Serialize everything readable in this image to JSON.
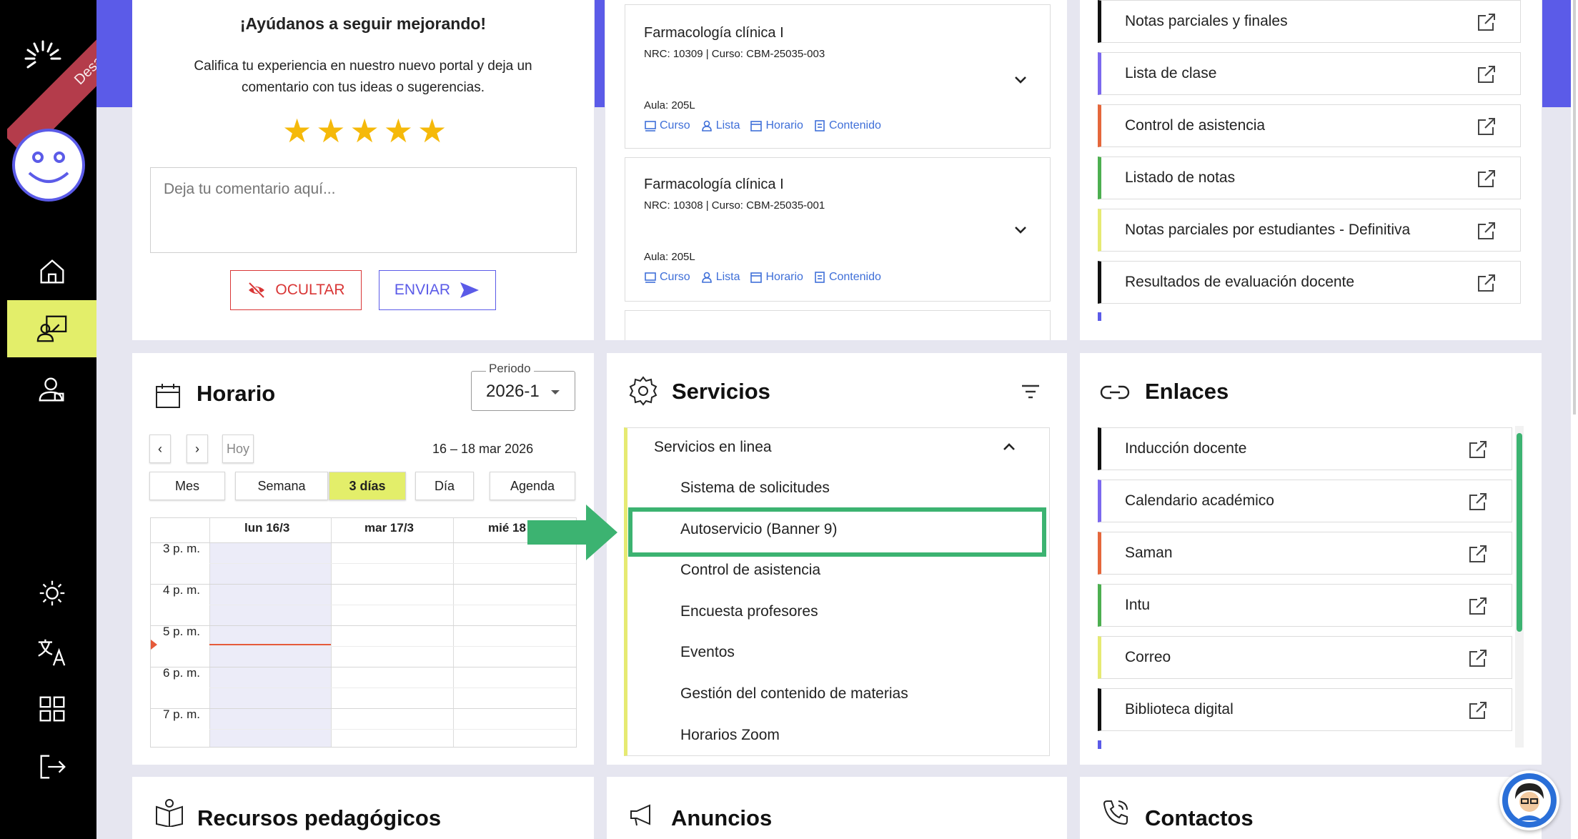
{
  "sidebar": {
    "ribbon_label": "Desarrollo",
    "items": [
      {
        "name": "home-icon"
      },
      {
        "name": "teacher-screen-icon"
      },
      {
        "name": "user-icon"
      },
      {
        "name": "theme-icon"
      },
      {
        "name": "language-icon"
      },
      {
        "name": "apps-grid-icon"
      },
      {
        "name": "logout-icon"
      }
    ]
  },
  "feedback": {
    "title": "¡Ayúdanos a seguir mejorando!",
    "text_line1": "Califica tu experiencia en nuestro nuevo portal y deja un",
    "text_line2": "comentario con tus ideas o sugerencias.",
    "stars": 5,
    "comment_placeholder": "Deja tu comentario aquí...",
    "hide_label": "OCULTAR",
    "send_label": "ENVIAR"
  },
  "courses": [
    {
      "name": "Farmacología clínica I",
      "nrc": "NRC: 10309 | Curso: CBM-25035-003",
      "aula": "Aula: 205L"
    },
    {
      "name": "Farmacología clínica I",
      "nrc": "NRC: 10308 | Curso: CBM-25035-001",
      "aula": "Aula: 205L"
    }
  ],
  "course_links": {
    "curso": "Curso",
    "lista": "Lista",
    "horario": "Horario",
    "contenido": "Contenido"
  },
  "reports": [
    {
      "label": "Notas parciales y finales",
      "color": "#111111"
    },
    {
      "label": "Lista de clase",
      "color": "#7b68ee"
    },
    {
      "label": "Control de asistencia",
      "color": "#e5673b"
    },
    {
      "label": "Listado de notas",
      "color": "#4caf50"
    },
    {
      "label": "Notas parciales por estudiantes - Definitiva",
      "color": "#e6ea72"
    },
    {
      "label": "Resultados de evaluación docente",
      "color": "#111111"
    }
  ],
  "horario": {
    "title": "Horario",
    "period_label": "Periodo",
    "period_value": "2026-1",
    "prev": "‹",
    "next": "›",
    "today": "Hoy",
    "range": "16 – 18 mar 2026",
    "views": [
      "Mes",
      "Semana",
      "3 días",
      "Día",
      "Agenda"
    ],
    "active_view": "3 días",
    "days": [
      "lun 16/3",
      "mar 17/3",
      "mié 18"
    ],
    "hours": [
      "3 p. m.",
      "4 p. m.",
      "5 p. m.",
      "6 p. m.",
      "7 p. m."
    ]
  },
  "servicios": {
    "title": "Servicios",
    "group": "Servicios en linea",
    "items": [
      "Sistema de solicitudes",
      "Autoservicio (Banner 9)",
      "Control de asistencia",
      "Encuesta profesores",
      "Eventos",
      "Gestión del contenido de materias",
      "Horarios Zoom"
    ],
    "highlighted": "Autoservicio (Banner 9)"
  },
  "enlaces": {
    "title": "Enlaces",
    "items": [
      {
        "label": "Inducción docente",
        "color": "#111111"
      },
      {
        "label": "Calendario académico",
        "color": "#7b68ee"
      },
      {
        "label": "Saman",
        "color": "#e5673b"
      },
      {
        "label": "Intu",
        "color": "#4caf50"
      },
      {
        "label": "Correo",
        "color": "#e6ea72"
      },
      {
        "label": "Biblioteca digital",
        "color": "#111111"
      }
    ]
  },
  "bottom": {
    "recursos": "Recursos pedagógicos",
    "anuncios": "Anuncios",
    "contactos": "Contactos"
  },
  "colors": {
    "accent": "#5b5be8",
    "highlight": "#3cb371",
    "active": "#e3ee6a",
    "link": "#3f6fd8",
    "danger": "#d93636"
  }
}
